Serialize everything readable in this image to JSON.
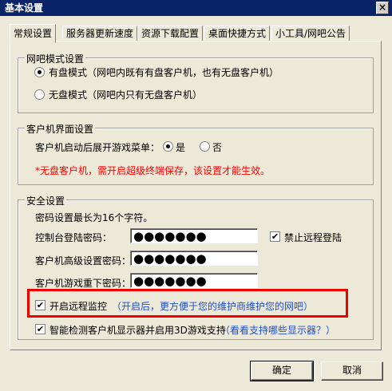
{
  "window": {
    "title": "基本设置",
    "close_glyph": "×"
  },
  "tabs": [
    "常规设置",
    "服务器更新速度",
    "资源下载配置",
    "桌面快捷方式",
    "小工具/网吧公告"
  ],
  "netbar_mode": {
    "title": "网吧模式设置",
    "option_disk": "有盘模式（网吧内既有有盘客户机，也有无盘客户机）",
    "option_diskless": "无盘模式（网吧内只有无盘客户机）"
  },
  "client_ui": {
    "title": "客户机界面设置",
    "expand_label": "客户机启动后展开游戏菜单：",
    "yes": "是",
    "no": "否",
    "warning": "*无盘客户机，需开启超级终端保存，该设置才能生效。"
  },
  "security": {
    "title": "安全设置",
    "hint": "密码设置最长为16个字符。",
    "console_label": "控制台登陆密码：",
    "console_pwd": "●●●●●●●",
    "ban_remote": "禁止远程登陆",
    "advanced_label": "客户机高级设置密码：",
    "advanced_pwd": "●●●●●●●",
    "reload_label": "客户机游戏重下密码：",
    "reload_pwd": "●●●●●●●"
  },
  "remote_monitor": {
    "label": "开启远程监控",
    "note": "（开启后，更方便于您的维护商维护您的网吧）"
  },
  "smart_detect": {
    "label": "智能检测客户机显示器并启用3D游戏支持",
    "link": "（看看支持哪些显示器？）"
  },
  "buttons": {
    "ok": "确定",
    "cancel": "取消"
  },
  "check_glyph": "✔"
}
